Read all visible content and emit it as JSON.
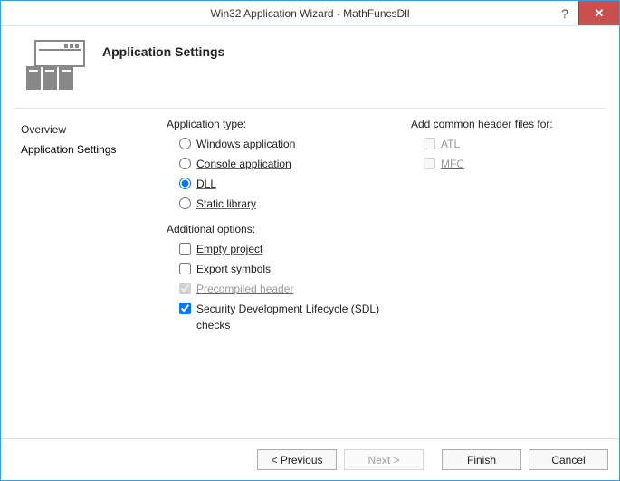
{
  "titlebar": {
    "title": "Win32 Application Wizard - MathFuncsDll",
    "help": "?",
    "close": "✕"
  },
  "header": {
    "page_title": "Application Settings"
  },
  "sidebar": {
    "items": [
      {
        "label": "Overview"
      },
      {
        "label": "Application Settings"
      }
    ]
  },
  "main": {
    "app_type_label": "Application type:",
    "app_type": [
      {
        "label": "Windows application",
        "checked": false
      },
      {
        "label": "Console application",
        "checked": false
      },
      {
        "label": "DLL",
        "checked": true
      },
      {
        "label": "Static library",
        "checked": false
      }
    ],
    "additional_label": "Additional options:",
    "additional": [
      {
        "label": "Empty project",
        "checked": false,
        "disabled": false
      },
      {
        "label": "Export symbols",
        "checked": false,
        "disabled": false
      },
      {
        "label": "Precompiled header",
        "checked": true,
        "disabled": true
      },
      {
        "label": "Security Development Lifecycle (SDL) checks",
        "checked": true,
        "disabled": false
      }
    ],
    "common_header_label": "Add common header files for:",
    "common_header": [
      {
        "label": "ATL",
        "checked": false,
        "disabled": true
      },
      {
        "label": "MFC",
        "checked": false,
        "disabled": true
      }
    ]
  },
  "footer": {
    "previous": "< Previous",
    "next": "Next >",
    "finish": "Finish",
    "cancel": "Cancel"
  }
}
